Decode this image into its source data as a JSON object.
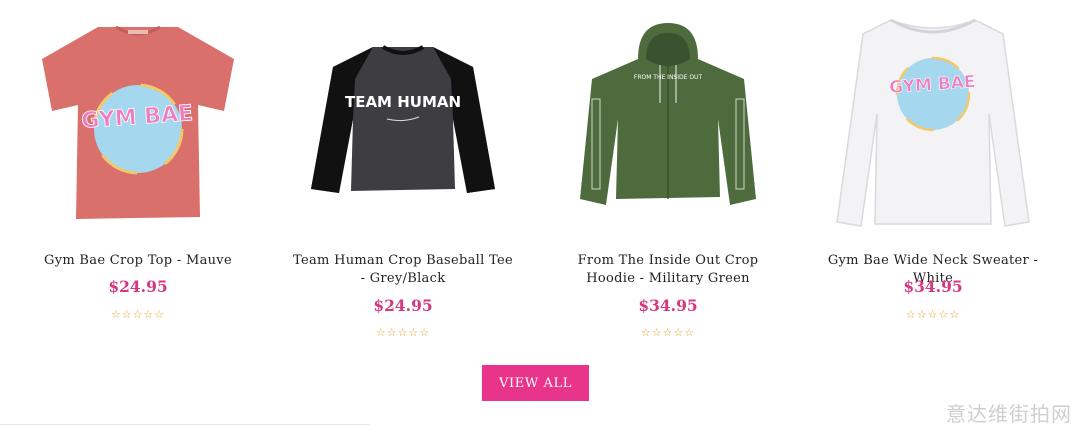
{
  "products": [
    {
      "name": "Gym Bae Crop Top - Mauve",
      "price": "$24.95",
      "rating": 0,
      "stars": "☆☆☆☆☆",
      "graphic_text": "GYM BAE"
    },
    {
      "name": "Team Human Crop Baseball Tee - Grey/Black",
      "price": "$24.95",
      "rating": 0,
      "stars": "☆☆☆☆☆",
      "graphic_text": "TEAM HUMAN"
    },
    {
      "name": "From The Inside Out Crop Hoodie - Military Green",
      "price": "$34.95",
      "rating": 0,
      "stars": "☆☆☆☆☆",
      "graphic_text": "FROM THE INSIDE OUT"
    },
    {
      "name": "Gym Bae Wide Neck Sweater - White",
      "price": "$34.95",
      "rating": 0,
      "stars": "☆☆☆☆☆",
      "graphic_text": "GYM BAE"
    }
  ],
  "view_all_label": "VIEW ALL",
  "watermark": "意达维街拍网",
  "colors": {
    "price": "#d7377f",
    "button": "#e9348c",
    "stars": "#e4a126",
    "mauve": "#d9706c",
    "green": "#4e6b3e"
  }
}
